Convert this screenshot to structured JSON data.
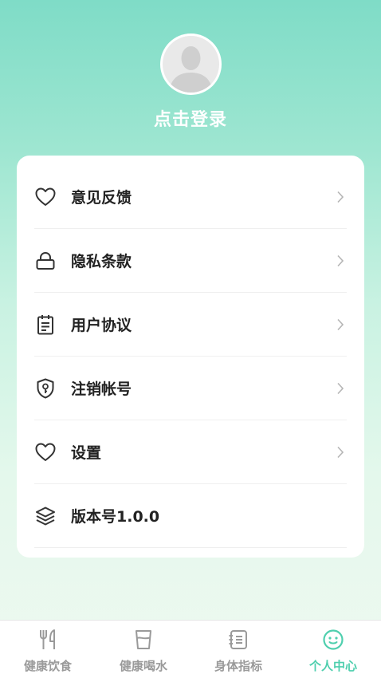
{
  "profile": {
    "login_label": "点击登录"
  },
  "menu": {
    "items": [
      {
        "label": "意见反馈",
        "icon": "heart-icon"
      },
      {
        "label": "隐私条款",
        "icon": "lock-icon"
      },
      {
        "label": "用户协议",
        "icon": "notepad-icon"
      },
      {
        "label": "注销帐号",
        "icon": "shield-key-icon"
      },
      {
        "label": "设置",
        "icon": "heart-icon"
      },
      {
        "label": "版本号1.0.0",
        "icon": "layers-icon"
      }
    ]
  },
  "tabbar": {
    "tabs": [
      {
        "label": "健康饮食",
        "icon": "utensils-icon"
      },
      {
        "label": "健康喝水",
        "icon": "cup-icon"
      },
      {
        "label": "身体指标",
        "icon": "notebook-icon"
      },
      {
        "label": "个人中心",
        "icon": "smiley-icon"
      }
    ],
    "active_index": 3
  },
  "colors": {
    "accent": "#4fcfae",
    "inactive": "#9a9a9a",
    "text": "#222222"
  }
}
